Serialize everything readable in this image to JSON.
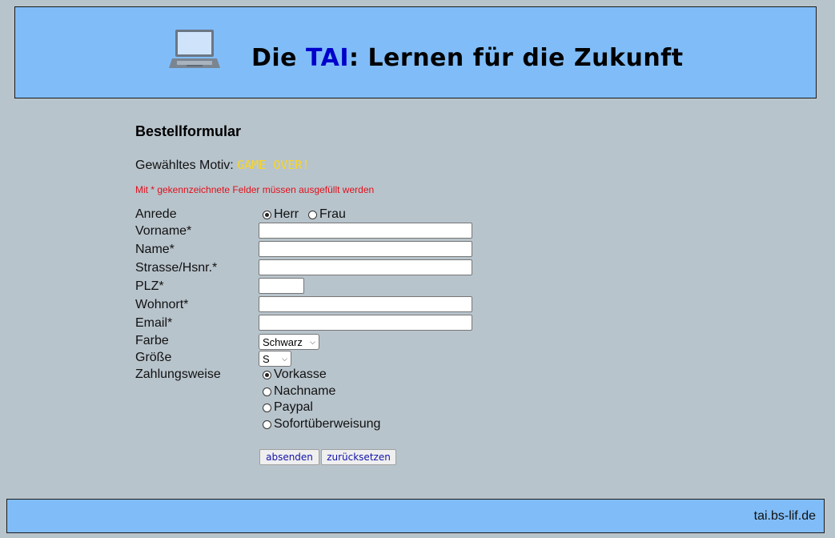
{
  "header": {
    "title_prefix": "Die ",
    "title_accent": "TAI",
    "title_suffix": ": Lernen für die Zukunft",
    "accent_color": "#0000cc",
    "background": "#80bdf8"
  },
  "form": {
    "heading": "Bestellformular",
    "motiv_label": "Gewähltes Motiv:",
    "motiv_value": "GAME OVER!",
    "required_hint": "Mit * gekennzeichnete Felder müssen ausgefüllt werden",
    "anrede": {
      "label": "Anrede",
      "options": [
        {
          "label": "Herr",
          "selected": true
        },
        {
          "label": "Frau",
          "selected": false
        }
      ]
    },
    "fields": {
      "vorname": {
        "label": "Vorname*",
        "value": ""
      },
      "name": {
        "label": "Name*",
        "value": ""
      },
      "strasse": {
        "label": "Strasse/Hsnr.*",
        "value": ""
      },
      "plz": {
        "label": "PLZ*",
        "value": ""
      },
      "wohnort": {
        "label": "Wohnort*",
        "value": ""
      },
      "email": {
        "label": "Email*",
        "value": ""
      }
    },
    "farbe": {
      "label": "Farbe",
      "selected": "Schwarz"
    },
    "groesse": {
      "label": "Größe",
      "selected": "S"
    },
    "zahlungsweise": {
      "label": "Zahlungsweise",
      "options": [
        {
          "label": "Vorkasse",
          "selected": true
        },
        {
          "label": "Nachname",
          "selected": false
        },
        {
          "label": "Paypal",
          "selected": false
        },
        {
          "label": "Sofortüberweisung",
          "selected": false
        }
      ]
    },
    "submit_label": "absenden",
    "reset_label": "zurücksetzen"
  },
  "footer": {
    "site": "tai.bs-lif.de"
  }
}
